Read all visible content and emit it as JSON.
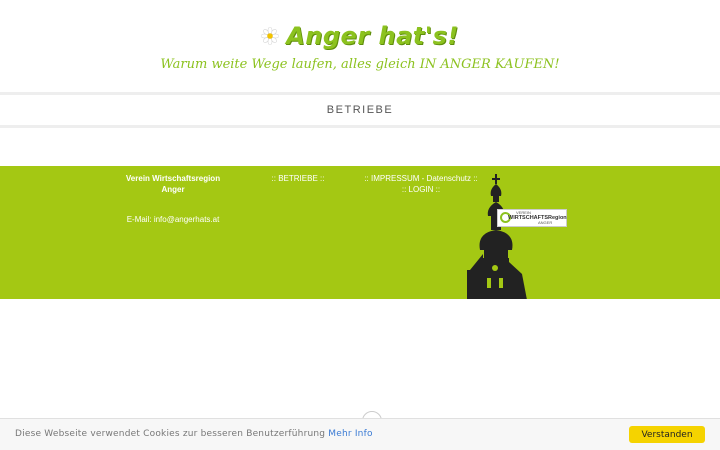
{
  "header": {
    "logo_text": "Anger hat's!",
    "slogan": "Warum weite Wege laufen, alles gleich IN ANGER KAUFEN!"
  },
  "nav": {
    "items": [
      {
        "label": "BETRIEBE"
      }
    ]
  },
  "footer": {
    "org_name_line1": "Verein Wirtschaftsregion",
    "org_name_line2": "Anger",
    "email_label": "E-Mail: ",
    "email": "info@angerhats.at",
    "link_betriebe": ":: BETRIEBE ::",
    "link_impressum": ":: IMPRESSUM - Datenschutz ::",
    "link_login": ":: LOGIN ::",
    "badge": {
      "line1": "VEREIN",
      "line2": "WIRTSCHAFTSRegion",
      "line3": "ANGER"
    }
  },
  "cookie": {
    "text": "Diese Webseite verwendet Cookies zur besseren Benutzerführung",
    "link": "Mehr Info",
    "button": "Verstanden"
  },
  "colors": {
    "brand_green": "#a4c813",
    "logo_green": "#8cc21f",
    "cookie_button": "#f5d300",
    "link_blue": "#3b7bd4"
  },
  "icons": {
    "logo": "daisy-flower-icon",
    "scroll": "chevron-up-icon"
  }
}
